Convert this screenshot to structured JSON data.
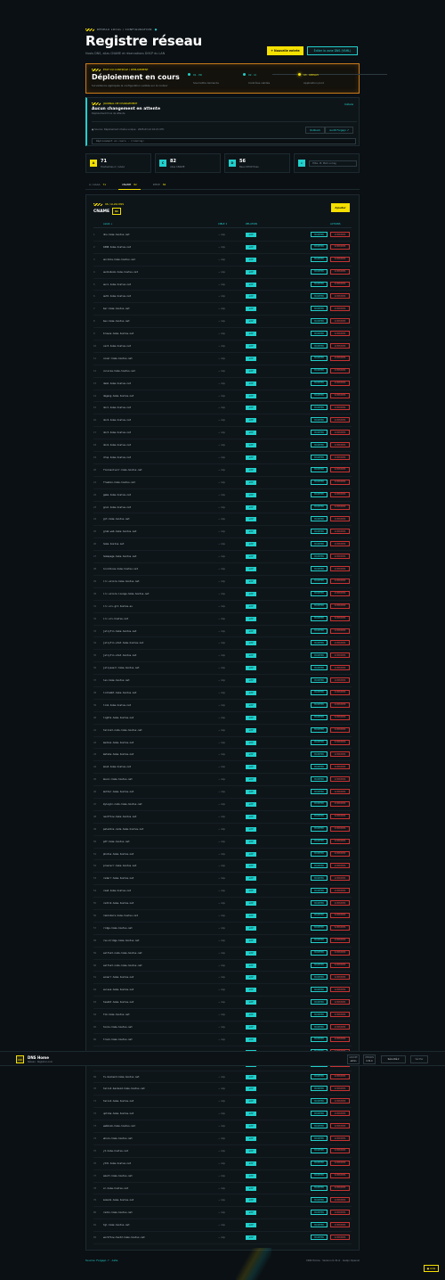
{
  "header": {
    "kicker": "RÉSEAU LOCAL / CONFIGURATION",
    "title": "Registre réseau",
    "subtitle": "Hosts DNS, alias CNAME et réservations DHCP du LAN",
    "new_entry": "+ Nouvelle entrée",
    "edit_zone": "Éditer la zone DNS (YAML)"
  },
  "deploy": {
    "kicker": "ÉTAT DU CONTRÔLE / DÉPLOIEMENT",
    "title": "Déploiement en cours",
    "subtitle": "Surveillance appliquée la configuration validée sur le routeur",
    "steps": [
      {
        "label": "01 · PR",
        "sub": "Soumettre demande",
        "color": "#21d0cc"
      },
      {
        "label": "02 · CI",
        "sub": "Contrôles validés",
        "color": "#21d0cc"
      },
      {
        "label": "03 · DEPLOY",
        "sub": "Application prod",
        "color": "#f5e000"
      }
    ]
  },
  "journal": {
    "kicker": "JOURNAL DE CHANGEMENT",
    "title": "Aucun changement en attente",
    "subtitle": "Déploiement hors de attente",
    "details": "Détails",
    "meta": "● Source: Déploiement chaîne unique · 2025-03-12 10:21 UTC",
    "rollback": "Rollback",
    "audit": "Audit Forgejo ↗",
    "input_placeholder": "Déploiement en cours · (running)"
  },
  "stats": [
    {
      "icon": "A",
      "value": "71",
      "label": "Hostnames A / AAAA",
      "color": "#f5e000"
    },
    {
      "icon": "C",
      "value": "82",
      "label": "Alias CNAME",
      "color": "#21d0cc"
    },
    {
      "icon": "D",
      "value": "56",
      "label": "Baux DHCP fixes",
      "color": "#21d0cc"
    }
  ],
  "search": {
    "placeholder": "Hôte, IP, MAC ou tag"
  },
  "tabs": [
    {
      "label": "A / AAAA",
      "count": "71"
    },
    {
      "label": "CNAME",
      "count": "82"
    },
    {
      "label": "DHCP",
      "count": "56"
    }
  ],
  "table": {
    "kicker": "06 / ALIAS DNS",
    "title": "CNAME",
    "badge": "82",
    "add": "Ajouter",
    "col_alias": "ALIAS ↓",
    "col_target": "CIBLE ↕",
    "col_status": "RELATION",
    "col_actions": "ACTIONS",
    "target_text": "→ nip",
    "status_text": "actif",
    "mod_text": "MODIFIER",
    "del_text": "SUPPRIMER",
    "rows": [
      "dns.home.hostus.net",
      "1808.home.hostus.net",
      "ancible.home.hostus.net",
      "audiobook.home.hostus.net",
      "auro.home.hostus.net",
      "auth.home.hostus.net",
      "bar.home.hostus.net",
      "bev.home.hostus.net",
      "browse.home.hostus.net",
      "card.home.hostus.net",
      "cover.home.hostus.net",
      "cuisine.home.hostus.net",
      "dash.home.hostus.net",
      "degeng.home.hostus.net",
      "docl.home.hostus.net",
      "doc2.home.hostus.net",
      "doct.home.hostus.net",
      "dock.home.hostus.net",
      "drop.home.hostus.net",
      "flaresolverr.home.hostus.net",
      "freebox.home.hostus.net",
      "game.home.hostus.net",
      "gcal.home.hostus.net",
      "git.home.hostus.net",
      "grab-web.home.hostus.net",
      "home.hostus.net",
      "homepage.home.hostus.net",
      "invidious.home.hostus.net",
      "irc.solore.home.hostus.net",
      "irc.solore.lounge.home.hostus.net",
      "irc.srv.git.hostus.eu",
      "irc.srv.hostus.net",
      "jellyfin.home.hostus.net",
      "jellyfin.stat.home.hostus.net",
      "jellyfin.stat.hostus.net",
      "jellyseerr.home.hostus.net",
      "lan.home.hostus.net",
      "lidrambt.home.hostus.net",
      "link.home.hostus.net",
      "lights.home.hostus.net",
      "tailnet.node.home.hostus.net",
      "median.home.hostus.net",
      "metube.home.hostus.net",
      "mood.home.hostus.net",
      "music.home.hostus.net",
      "mutter.home.hostus.net",
      "mylogin.node.home.hostus.net",
      "nextflow.home.hostus.net",
      "paladins.node.home.hostus.net",
      "pdf.home.hostus.net",
      "photos.home.hostus.net",
      "prowlarr.home.hostus.net",
      "radarr.home.hostus.net",
      "read.home.hostus.net",
      "redlib.home.hostus.net",
      "reminders.home.hostus.net",
      "ridge.home.hostus.net",
      "rss-bridge.home.hostus.net",
      "selfnet.node.home.hostus.net",
      "selfnet.node.home.hostus.net",
      "sonarr.home.hostus.net",
      "suisse.home.hostus.net",
      "taskbt.home.hostus.net",
      "tlk.home.hostus.net",
      "tools.home.hostus.net",
      "track.home.hostus.net",
      "trans.home.hostus.net",
      "tv.home.hostus.net",
      "tv-backend.home.hostus.net",
      "tailsh.backend.home.hostus.net",
      "tailsh.home.hostus.net",
      "uptime.home.hostus.net",
      "webhook.home.hostus.net",
      "whois.home.hostus.net",
      "yt.home.hostus.net",
      "ytdl.home.hostus.net",
      "smart.home.hostus.net",
      "zc.home.hostus.net",
      "komodo.home.hostus.net",
      "radio.home.hostus.net",
      "tgl.home.hostus.net",
      "workflow-test2.home.hostus.net"
    ]
  },
  "overlay": {
    "logo": "DN",
    "name": "DNS Home",
    "sub": "Réseau · Registre Local",
    "chip1_label": "GROUPE",
    "chip1_value": "admin",
    "chip2_label": "VERSION",
    "chip2_value": "0.31.0",
    "select": "Sécurité ▾",
    "verify": "Vérifier"
  },
  "footer": {
    "left": "Source: Forgejo ↗ · Aide",
    "right": "DNS Home · Version 0.31.0 · Gelijo OpenAI",
    "corner": "● Aide"
  }
}
